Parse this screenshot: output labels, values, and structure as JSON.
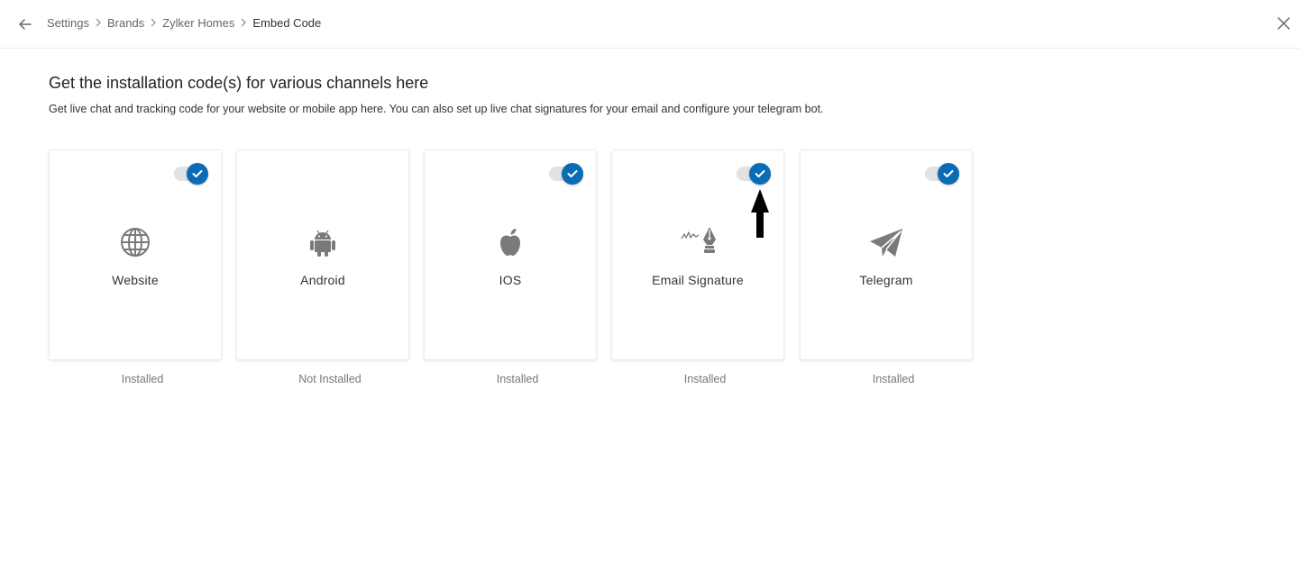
{
  "header": {
    "back_icon": "arrow-left-icon",
    "breadcrumb": [
      "Settings",
      "Brands",
      "Zylker Homes",
      "Embed Code"
    ],
    "separator_icon": "chevron-right-icon",
    "close_icon": "close-icon"
  },
  "main": {
    "title": "Get the installation code(s) for various channels here",
    "subtitle": "Get live chat and tracking code for your website or mobile app here. You can also set up live chat signatures for your email and configure your telegram bot."
  },
  "channels": [
    {
      "label": "Website",
      "icon": "globe-icon",
      "toggle_on": true,
      "status": "Installed"
    },
    {
      "label": "Android",
      "icon": "android-icon",
      "toggle_on": false,
      "status": "Not Installed"
    },
    {
      "label": "IOS",
      "icon": "apple-icon",
      "toggle_on": true,
      "status": "Installed"
    },
    {
      "label": "Email Signature",
      "icon": "pen-signature-icon",
      "toggle_on": true,
      "status": "Installed"
    },
    {
      "label": "Telegram",
      "icon": "paper-plane-icon",
      "toggle_on": true,
      "status": "Installed"
    }
  ],
  "colors": {
    "accent": "#0a6bb7",
    "toggle_track": "#e2e2e2",
    "icon_gray": "#7a7a7a",
    "status_text": "#777777"
  }
}
